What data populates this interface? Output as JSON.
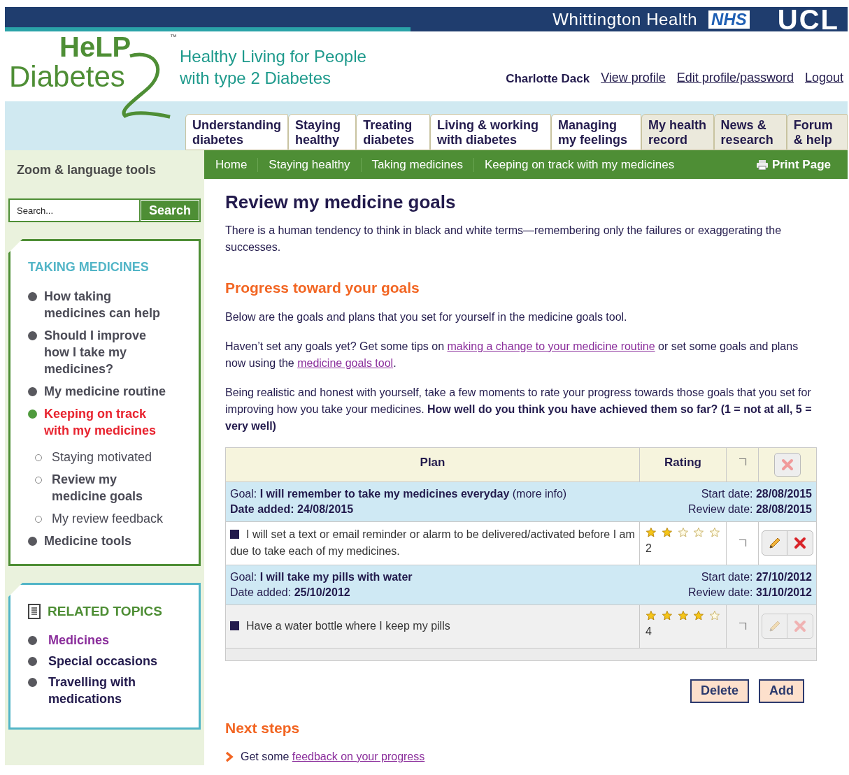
{
  "header": {
    "org": "Whittington Health",
    "nhs": "NHS",
    "ucl": "UCL",
    "logo_top": "HeLP",
    "logo_bottom": "Diabetes",
    "trademark": "™",
    "tagline": [
      "Healthy Living for People",
      "with type 2 Diabetes"
    ],
    "user": "Charlotte Dack",
    "links": [
      "View profile",
      "Edit profile/password",
      "Logout"
    ]
  },
  "nav_tabs": [
    {
      "label": "Understanding diabetes",
      "shaded": false
    },
    {
      "label": "Staying healthy",
      "shaded": false
    },
    {
      "label": "Treating diabetes",
      "shaded": false
    },
    {
      "label": "Living & working with diabetes",
      "shaded": false
    },
    {
      "label": "Managing my feelings",
      "shaded": false
    },
    {
      "label": "My health record",
      "shaded": true
    },
    {
      "label": "News & research",
      "shaded": true
    },
    {
      "label": "Forum & help",
      "shaded": true
    }
  ],
  "sidebar": {
    "tools": "Zoom & language tools",
    "search": {
      "placeholder": "Search...",
      "button": "Search"
    },
    "section": {
      "title": "TAKING MEDICINES",
      "items": [
        {
          "label": "How taking medicines can help",
          "selected": false
        },
        {
          "label": "Should I improve how I take my medicines?",
          "selected": false
        },
        {
          "label": "My medicine routine",
          "selected": false
        },
        {
          "label": "Keeping on track with my medicines",
          "selected": true,
          "children": [
            {
              "label": "Staying motivated",
              "selected": false
            },
            {
              "label": "Review my medicine goals",
              "selected": true
            },
            {
              "label": "My review feedback",
              "selected": false
            }
          ]
        },
        {
          "label": "Medicine tools",
          "selected": false
        }
      ]
    },
    "related": {
      "title": "RELATED TOPICS",
      "items": [
        {
          "label": "Medicines",
          "visited": true
        },
        {
          "label": "Special occasions",
          "visited": false
        },
        {
          "label": "Travelling with medications",
          "visited": false
        }
      ]
    }
  },
  "breadcrumbs": [
    "Home",
    "Staying healthy",
    "Taking medicines",
    "Keeping on track with my medicines"
  ],
  "print": "Print Page",
  "content": {
    "title": "Review my medicine goals",
    "intro": "There is a human tendency to think in black and white terms—remembering only the failures or exaggerating the successes.",
    "progress_heading": "Progress toward your goals",
    "paragraphs": [
      [
        {
          "text": "Below are the goals and plans that you set for yourself in the medicine goals tool."
        }
      ],
      [
        {
          "text": "Haven’t set any goals yet? Get some tips on "
        },
        {
          "link": "making a change to your medicine routine"
        },
        {
          "text": " or set some goals and plans now using the "
        },
        {
          "link": "medicine goals tool"
        },
        {
          "text": "."
        }
      ],
      [
        {
          "text": "Being realistic and honest with yourself, take a few moments to rate your progress towards those goals that you set for improving how you take your medicines. **How well do you think you have achieved them so far? (1 = not at all, 5 = very well)**"
        }
      ]
    ],
    "table": {
      "columns": [
        "Plan",
        "Rating"
      ],
      "goals": [
        {
          "goal": "Goal: **I will remember to take my medicines everyday** (more info)",
          "date_added": "**Date added: 24/08/2015**",
          "start_date": "Start date: **28/08/2015**",
          "review_date": "Review date: **28/08/2015**",
          "plans": [
            {
              "text": "I will set a text or email reminder or alarm to be delivered/activated before I am due to take each of my medicines.",
              "stars": 2,
              "reading": "2",
              "disabled": false
            }
          ]
        },
        {
          "goal": "Goal: **I will take my pills with water**",
          "date_added": "Date added: **25/10/2012**",
          "start_date": "Start date: **27/10/2012**",
          "review_date": "Review date: **31/10/2012**",
          "plans": [
            {
              "text": "Have a water bottle where I keep my pills",
              "stars": 4,
              "reading": "4",
              "disabled": true
            }
          ]
        }
      ]
    },
    "buttons": [
      "Delete",
      "Add"
    ],
    "next_heading": "Next steps",
    "next_items": [
      [
        {
          "text": "Get some "
        },
        {
          "link": "feedback on your progress"
        }
      ]
    ]
  }
}
